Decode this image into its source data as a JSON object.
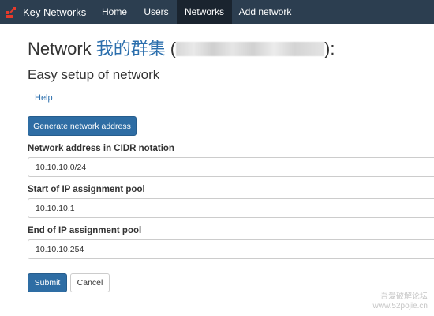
{
  "navbar": {
    "brand": "Key Networks",
    "items": [
      {
        "label": "Home"
      },
      {
        "label": "Users"
      },
      {
        "label": "Networks"
      },
      {
        "label": "Add network"
      }
    ],
    "active": "Networks",
    "colors": {
      "background": "#2c3e50",
      "active_background": "#1a242f",
      "brand_icon": "#e63a2b"
    }
  },
  "title": {
    "prefix": "Network",
    "name": "我的群集",
    "open_paren": "(",
    "close": "):"
  },
  "subtitle": "Easy setup of network",
  "help_link": "Help",
  "generate_button": "Generate network address",
  "fields": [
    {
      "label": "Network address in CIDR notation",
      "value": "10.10.10.0/24"
    },
    {
      "label": "Start of IP assignment pool",
      "value": "10.10.10.1"
    },
    {
      "label": "End of IP assignment pool",
      "value": "10.10.10.254"
    }
  ],
  "actions": {
    "submit": "Submit",
    "cancel": "Cancel"
  },
  "watermark": {
    "line1": "吾爱破解论坛",
    "line2": "www.52pojie.cn"
  },
  "colors": {
    "primary": "#2e6da4",
    "link": "#2c6fad"
  }
}
